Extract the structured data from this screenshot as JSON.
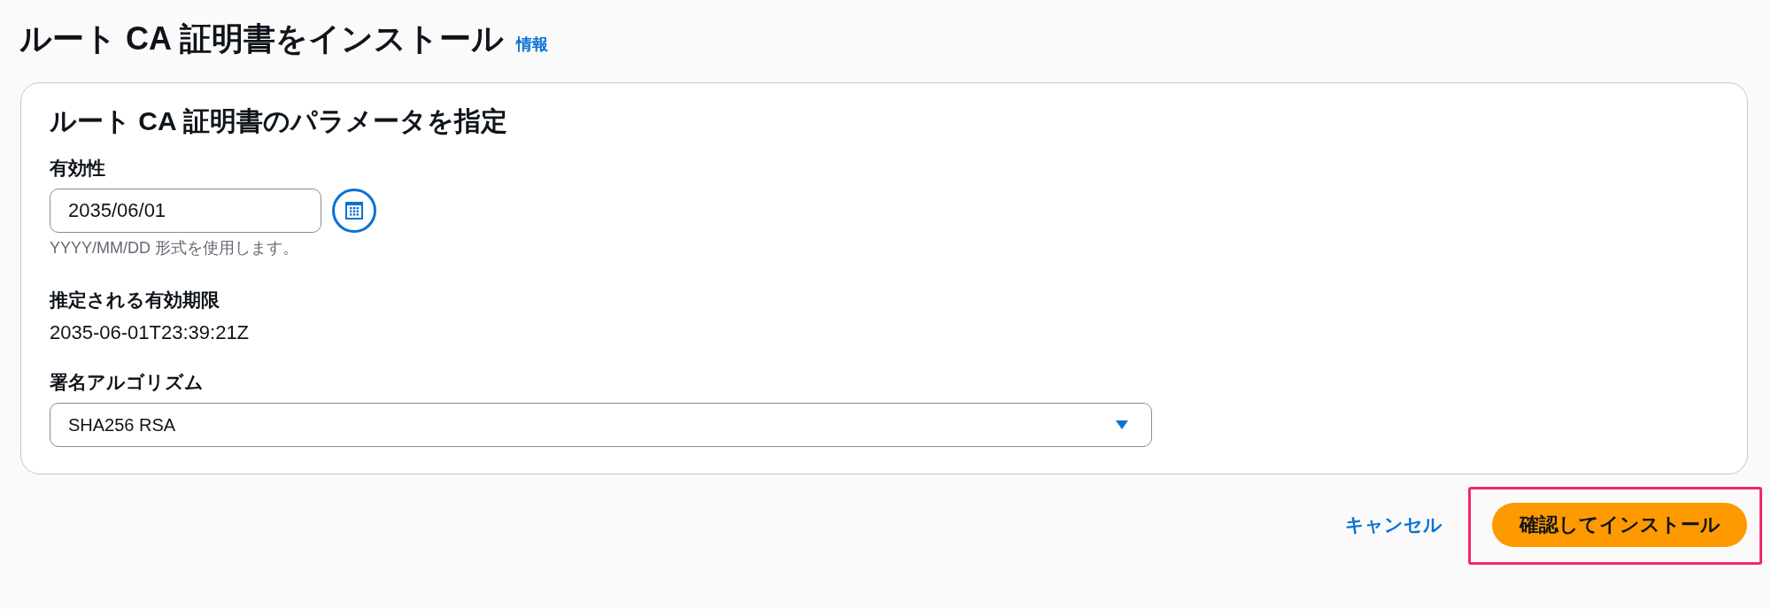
{
  "page": {
    "title": "ルート CA 証明書をインストール",
    "info_link": "情報"
  },
  "card": {
    "heading": "ルート CA 証明書のパラメータを指定",
    "fields": [
      {
        "kind": "date",
        "label": "有効性",
        "value": "2035/06/01",
        "hint": "YYYY/MM/DD 形式を使用します。"
      },
      {
        "kind": "readonly",
        "label": "推定される有効期限",
        "value": "2035-06-01T23:39:21Z"
      },
      {
        "kind": "select",
        "label": "署名アルゴリズム",
        "value": "SHA256 RSA"
      }
    ]
  },
  "actions": [
    {
      "kind": "link",
      "label": "キャンセル",
      "highlighted": false
    },
    {
      "kind": "primary",
      "label": "確認してインストール",
      "highlighted": true
    }
  ]
}
